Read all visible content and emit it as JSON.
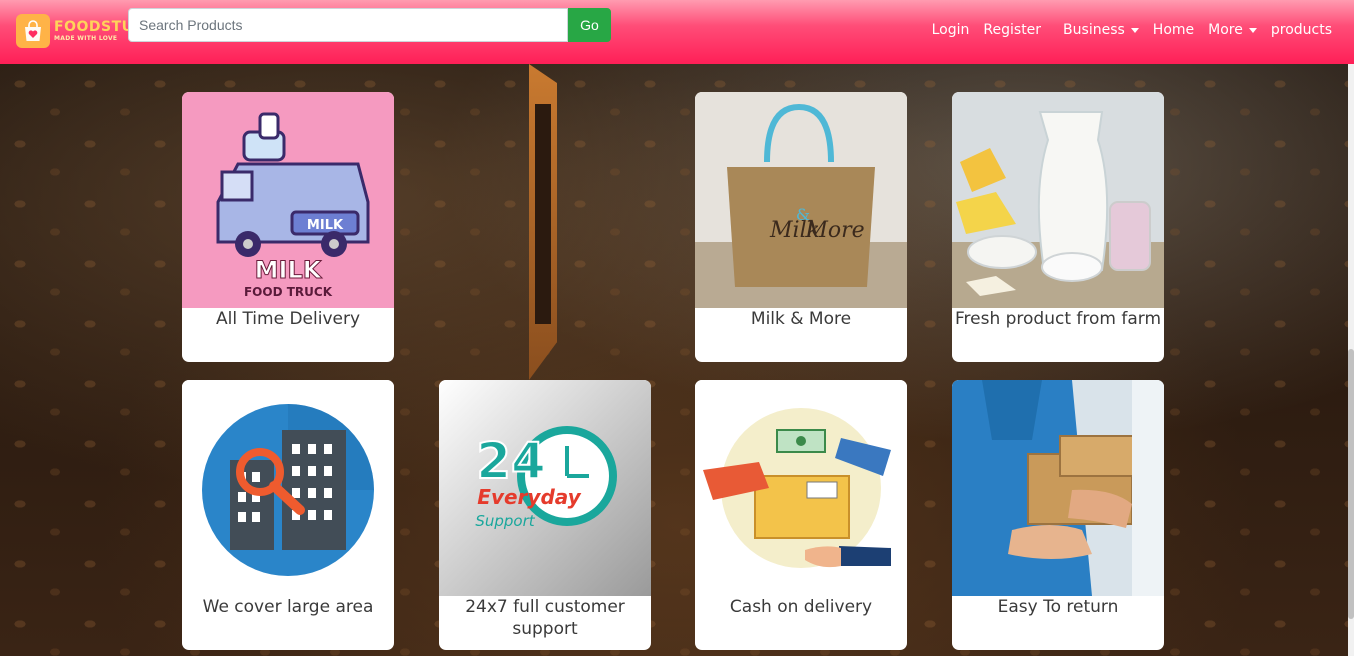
{
  "brand": {
    "name": "FOODSTUF",
    "tagline": "MADE WITH LOVE"
  },
  "search": {
    "placeholder": "Search Products",
    "value": "",
    "button_label": "Go"
  },
  "nav": {
    "items": [
      {
        "label": "Login",
        "has_caret": false
      },
      {
        "label": "Register",
        "has_caret": false
      },
      {
        "label": "Business",
        "has_caret": true
      },
      {
        "label": "Home",
        "has_caret": false
      },
      {
        "label": "More",
        "has_caret": true
      },
      {
        "label": "products",
        "has_caret": false
      }
    ]
  },
  "cards": [
    {
      "title": "All Time Delivery",
      "image": "milk-food-truck",
      "image_text": [
        "MILK",
        "FOOD TRUCK",
        "MILK"
      ]
    },
    {
      "title": "Milk & More",
      "image": "jute-bag",
      "image_text": [
        "Milk",
        "&",
        "More"
      ]
    },
    {
      "title": "Fresh product from farm",
      "image": "dairy-products"
    },
    {
      "title": "We cover large area",
      "image": "building-search-icon"
    },
    {
      "title": "24x7 full customer support",
      "image": "24-everyday-support",
      "image_text": [
        "24",
        "Everyday",
        "Support"
      ]
    },
    {
      "title": "Cash on delivery",
      "image": "cash-on-delivery-illustration"
    },
    {
      "title": "Easy To return",
      "image": "package-handover-photo"
    }
  ],
  "colors": {
    "navbar": "#ff1f57",
    "go_button": "#28a745",
    "card_bg": "#ffffff"
  }
}
